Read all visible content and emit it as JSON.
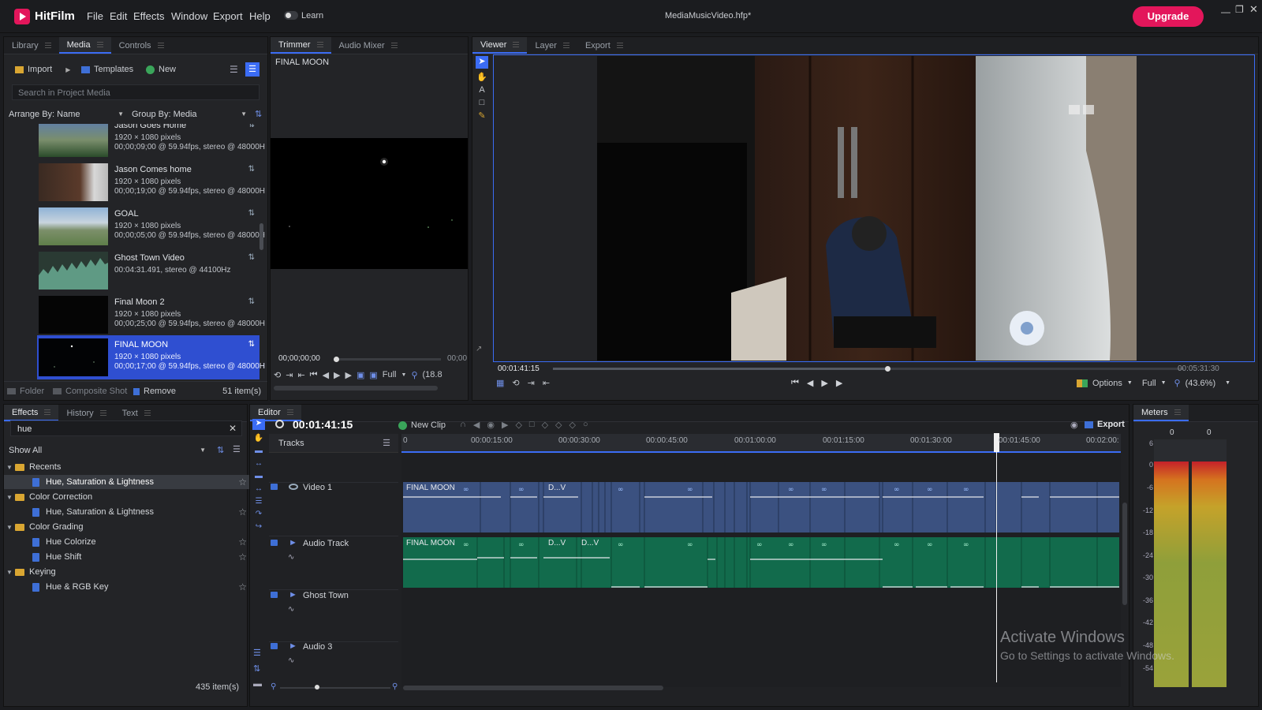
{
  "app": {
    "name": "HitFilm",
    "menu": [
      "File",
      "Edit",
      "Effects",
      "Window",
      "Export",
      "Help"
    ],
    "learn_label": "Learn",
    "project_title": "MediaMusicVideo.hfp*",
    "upgrade_label": "Upgrade",
    "brand_color": "#e3165b"
  },
  "media_panel": {
    "tabs": [
      "Library",
      "Media",
      "Controls"
    ],
    "import_label": "Import",
    "templates_label": "Templates",
    "new_label": "New",
    "search_placeholder": "Search in Project Media",
    "arrange_label": "Arrange By: Name",
    "group_label": "Group By: Media",
    "items": [
      {
        "name": "Jason Goes Home",
        "line1": "1920 × 1080 pixels",
        "line2": "00;00;09;00 @ 59.94fps, stereo @ 48000H"
      },
      {
        "name": "Jason Comes home",
        "line1": "1920 × 1080 pixels",
        "line2": "00;00;19;00 @ 59.94fps, stereo @ 48000H"
      },
      {
        "name": "GOAL",
        "line1": "1920 × 1080 pixels",
        "line2": "00;00;05;00 @ 59.94fps, stereo @ 48000H"
      },
      {
        "name": "Ghost Town Video",
        "line1": "00:04:31.491, stereo @ 44100Hz",
        "line2": ""
      },
      {
        "name": "Final Moon 2",
        "line1": "1920 × 1080 pixels",
        "line2": "00;00;25;00 @ 59.94fps, stereo @ 48000H"
      },
      {
        "name": "FINAL MOON",
        "line1": "1920 × 1080 pixels",
        "line2": "00;00;17;00 @ 59.94fps, stereo @ 48000H"
      }
    ],
    "footer_folder": "Folder",
    "footer_composite": "Composite Shot",
    "footer_remove": "Remove",
    "count": "51 item(s)"
  },
  "trimmer": {
    "tabs": [
      "Trimmer",
      "Audio Mixer"
    ],
    "clip_label": "FINAL MOON",
    "timecode_start": "00;00;00;00",
    "timecode_end": "00;00",
    "quality": "Full",
    "zoom": "(18.8"
  },
  "viewer": {
    "tabs": [
      "Viewer",
      "Layer",
      "Export"
    ],
    "timecode_current": "00:01:41:15",
    "timecode_end": "00:05:31:30",
    "options_label": "Options",
    "quality": "Full",
    "zoom": "(43.6%)",
    "playhead_fraction": 0.53
  },
  "effects_panel": {
    "tabs": [
      "Effects",
      "History",
      "Text"
    ],
    "search_value": "hue",
    "filter": "Show All",
    "tree": [
      {
        "type": "folder",
        "label": "Recents"
      },
      {
        "type": "effect",
        "label": "Hue, Saturation & Lightness",
        "selected": true
      },
      {
        "type": "folder",
        "label": "Color Correction"
      },
      {
        "type": "effect",
        "label": "Hue, Saturation & Lightness"
      },
      {
        "type": "folder",
        "label": "Color Grading"
      },
      {
        "type": "effect",
        "label": "Hue Colorize"
      },
      {
        "type": "effect",
        "label": "Hue Shift"
      },
      {
        "type": "folder",
        "label": "Keying"
      },
      {
        "type": "effect",
        "label": "Hue & RGB Key"
      }
    ],
    "count": "435 item(s)"
  },
  "editor": {
    "tab": "Editor",
    "timecode": "00:01:41:15",
    "new_clip_label": "New Clip",
    "export_label": "Export",
    "tracks_label": "Tracks",
    "ruler": [
      "0",
      "00:00:15:00",
      "00:00:30:00",
      "00:00:45:00",
      "00:01:00:00",
      "00:01:15:00",
      "00:01:30:00",
      "00:01:45:00",
      "00:02:00:"
    ],
    "tracks": [
      "Video 1",
      "Audio Track",
      "Ghost Town",
      "Audio 3"
    ],
    "video_clip_labels": [
      "FINAL MOON",
      "D...V"
    ],
    "audio_clip_labels": [
      "FINAL MOON",
      "D...V",
      "D...V"
    ],
    "playhead_time": "00:01:41:15"
  },
  "meters": {
    "tab": "Meters",
    "peak_left": "0",
    "peak_right": "0",
    "scale": [
      "6",
      "0",
      "-6",
      "-12",
      "-18",
      "-24",
      "-30",
      "-36",
      "-42",
      "-48",
      "-54"
    ]
  },
  "watermark": {
    "line1": "Activate Windows",
    "line2": "Go to Settings to activate Windows."
  }
}
